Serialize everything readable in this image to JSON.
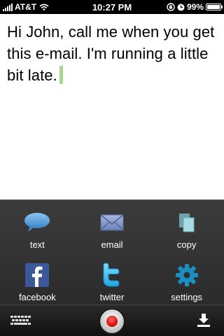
{
  "status_bar": {
    "carrier": "AT&T",
    "time": "10:27 PM",
    "battery": "99%",
    "battery_level": 0.99
  },
  "note": {
    "text": "Hi John, call me when you get this e-mail. I'm running a little bit late."
  },
  "actions": [
    {
      "label": "text",
      "icon": "speech-bubble-icon"
    },
    {
      "label": "email",
      "icon": "envelope-icon"
    },
    {
      "label": "copy",
      "icon": "copy-icon"
    },
    {
      "label": "facebook",
      "icon": "facebook-icon"
    },
    {
      "label": "twitter",
      "icon": "twitter-icon"
    },
    {
      "label": "settings",
      "icon": "gear-icon"
    }
  ],
  "toolbar": {
    "keyboard_icon": "keyboard-icon",
    "record_icon": "record-button-icon",
    "download_icon": "download-icon"
  },
  "colors": {
    "panel_bg": "#333333",
    "text_icon_blue": "#5b9bd5",
    "facebook_blue": "#3b5998",
    "twitter_blue": "#33b5e5",
    "settings_teal": "#1a8fc0",
    "record_red": "#d10000",
    "cursor_green": "#a8d890"
  }
}
